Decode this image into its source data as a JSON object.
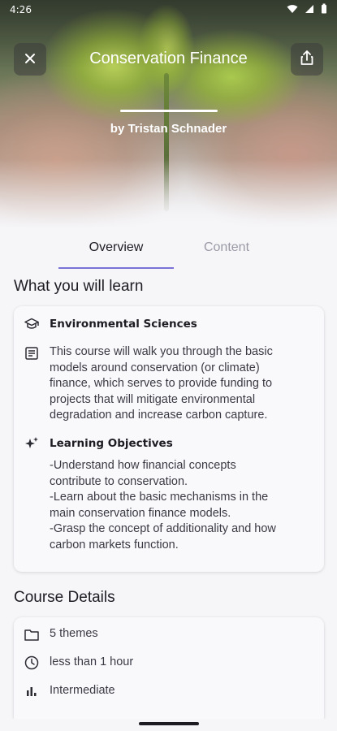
{
  "status": {
    "time": "4:26"
  },
  "header": {
    "title": "Conservation Finance",
    "author": "by Tristan Schnader"
  },
  "tabs": [
    {
      "label": "Overview",
      "active": true
    },
    {
      "label": "Content",
      "active": false
    }
  ],
  "learn": {
    "section_title": "What you will learn",
    "subject": "Environmental Sciences",
    "description": "This course will walk you through the basic\nmodels around conservation (or climate)\nfinance, which serves to provide funding to\nprojects that will mitigate environmental\ndegradation and increase carbon capture.",
    "objectives_title": "Learning Objectives",
    "objectives": "-Understand how financial concepts\ncontribute to conservation.\n-Learn about the basic mechanisms in the\nmain conservation finance models.\n-Grasp the concept of additionality and how\ncarbon markets function."
  },
  "details": {
    "section_title": "Course Details",
    "themes": "5 themes",
    "duration": "less than 1 hour",
    "level": "Intermediate"
  },
  "colors": {
    "accent": "#7a72d6",
    "background": "#f6f6f9"
  }
}
